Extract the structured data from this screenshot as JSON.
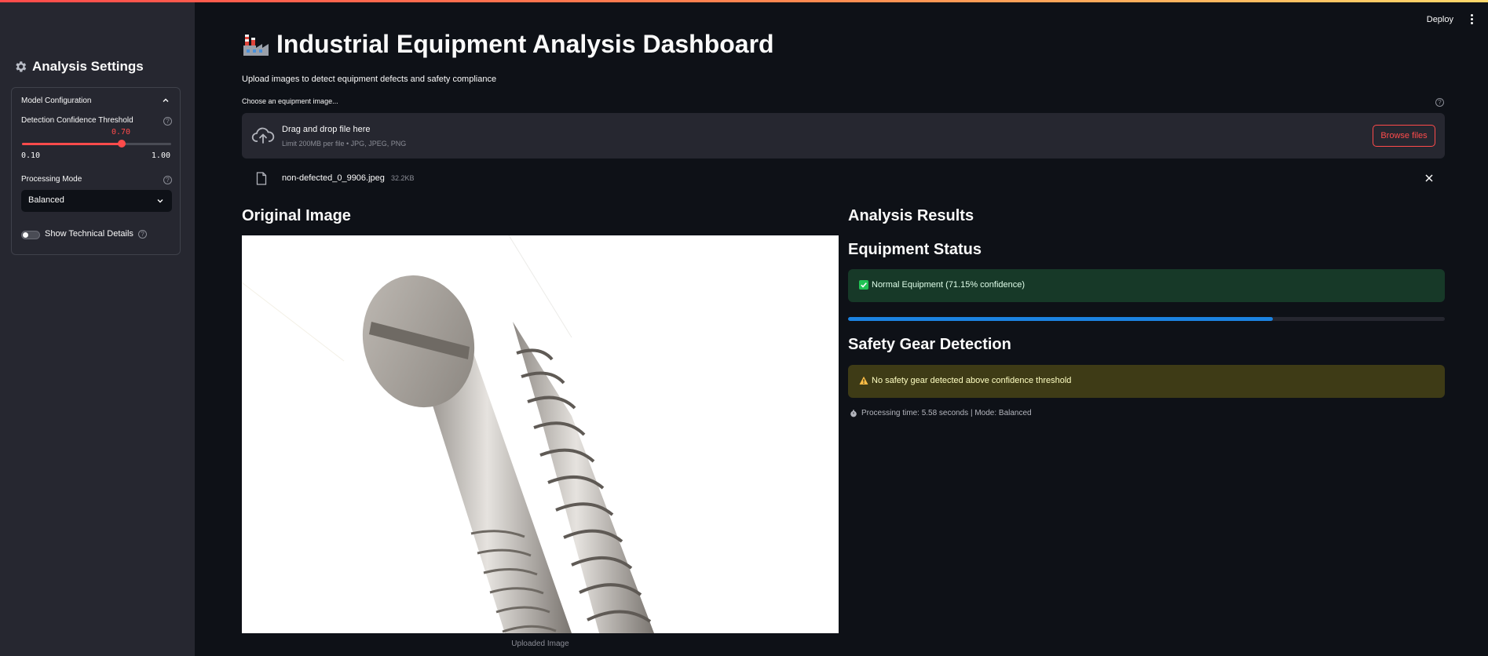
{
  "header": {
    "deploy_label": "Deploy"
  },
  "sidebar": {
    "title": "Analysis Settings",
    "expander": {
      "title": "Model Configuration",
      "slider": {
        "label": "Detection Confidence Threshold",
        "value": 0.7,
        "value_text": "0.70",
        "min_text": "0.10",
        "max_text": "1.00",
        "min": 0.1,
        "max": 1.0
      },
      "select": {
        "label": "Processing Mode",
        "value": "Balanced"
      },
      "toggle": {
        "label": "Show Technical Details",
        "checked": false
      }
    }
  },
  "main": {
    "title": "Industrial Equipment Analysis Dashboard",
    "subtitle": "Upload images to detect equipment defects and safety compliance",
    "uploader": {
      "label": "Choose an equipment image...",
      "drop_title": "Drag and drop file here",
      "limit_text": "Limit 200MB per file • JPG, JPEG, PNG",
      "browse_label": "Browse files",
      "file_name": "non-defected_0_9906.jpeg",
      "file_size": "32.2KB"
    },
    "original": {
      "heading": "Original Image",
      "caption": "Uploaded Image"
    },
    "results": {
      "heading": "Analysis Results",
      "status_heading": "Equipment Status",
      "status_text": "Normal Equipment (71.15% confidence)",
      "confidence": 0.7115,
      "safety_heading": "Safety Gear Detection",
      "safety_text": "No safety gear detected above confidence threshold",
      "processing_text": "Processing time: 5.58 seconds | Mode: Balanced"
    }
  },
  "colors": {
    "accent": "#ff4b4b",
    "success_bg": "#173928",
    "warning_bg": "#3e3b16",
    "progress": "#1c83e1",
    "background": "#0e1117",
    "sidebar": "#262730"
  }
}
